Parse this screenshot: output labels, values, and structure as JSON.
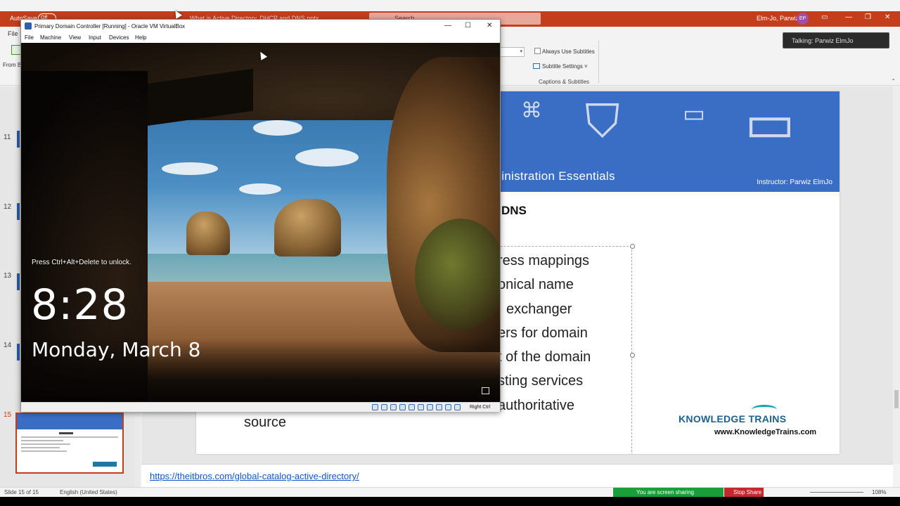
{
  "powerpoint": {
    "autosave_label": "AutoSave",
    "autosave_state": "Off",
    "doc_title": "What is Active Directory, DHCP and DNS.pptx",
    "search_placeholder": "Search",
    "user_name": "Elm-Jo, Parwiz",
    "user_initials": "EP",
    "file_tab": "File",
    "from_beginning_label": "From Beginning",
    "always_use_subtitles": "Always Use Subtitles",
    "subtitle_settings": "Subtitle Settings",
    "captions_group_label": "Captions & Subtitles",
    "slide_numbers": [
      "11",
      "12",
      "13",
      "14",
      "15"
    ],
    "active_slide": "15"
  },
  "teams_popup": {
    "text": "Talking: Parwiz ElmJo"
  },
  "slide": {
    "header_title": "dministration Essentials",
    "instructor": "Instructor: Parwiz ElmJo",
    "heading": "DNS",
    "bullet_lines": [
      "ress mappings",
      "onical name",
      "exchanger",
      "ers for domain",
      "t of the domain",
      "sting services",
      "authoritative",
      "source"
    ],
    "brand_name": "KNOWLEDGE TRAINS",
    "brand_url": "www.KnowledgeTrains.com"
  },
  "notes": {
    "link": "https://theitbros.com/global-catalog-active-directory/"
  },
  "status_bar": {
    "slide_indicator": "Slide 15 of 15",
    "language": "English (United States)",
    "screen_sharing": "You are screen sharing",
    "stop_share": "Stop Share",
    "zoom": "108%"
  },
  "virtualbox": {
    "title": "Primary Domain Controller [Running] - Oracle VM VirtualBox",
    "menu": [
      "File",
      "Machine",
      "View",
      "Input",
      "Devices",
      "Help"
    ],
    "host_key": "Right Ctrl"
  },
  "lock_screen": {
    "hint": "Press Ctrl+Alt+Delete to unlock.",
    "time": "8:28",
    "date": "Monday, March 8"
  },
  "colors": {
    "ppt_accent": "#c43e1c",
    "slide_header": "#3a6ec4",
    "share_green": "#1a9e3a",
    "stop_red": "#c4282c",
    "link_blue": "#1155cc"
  }
}
